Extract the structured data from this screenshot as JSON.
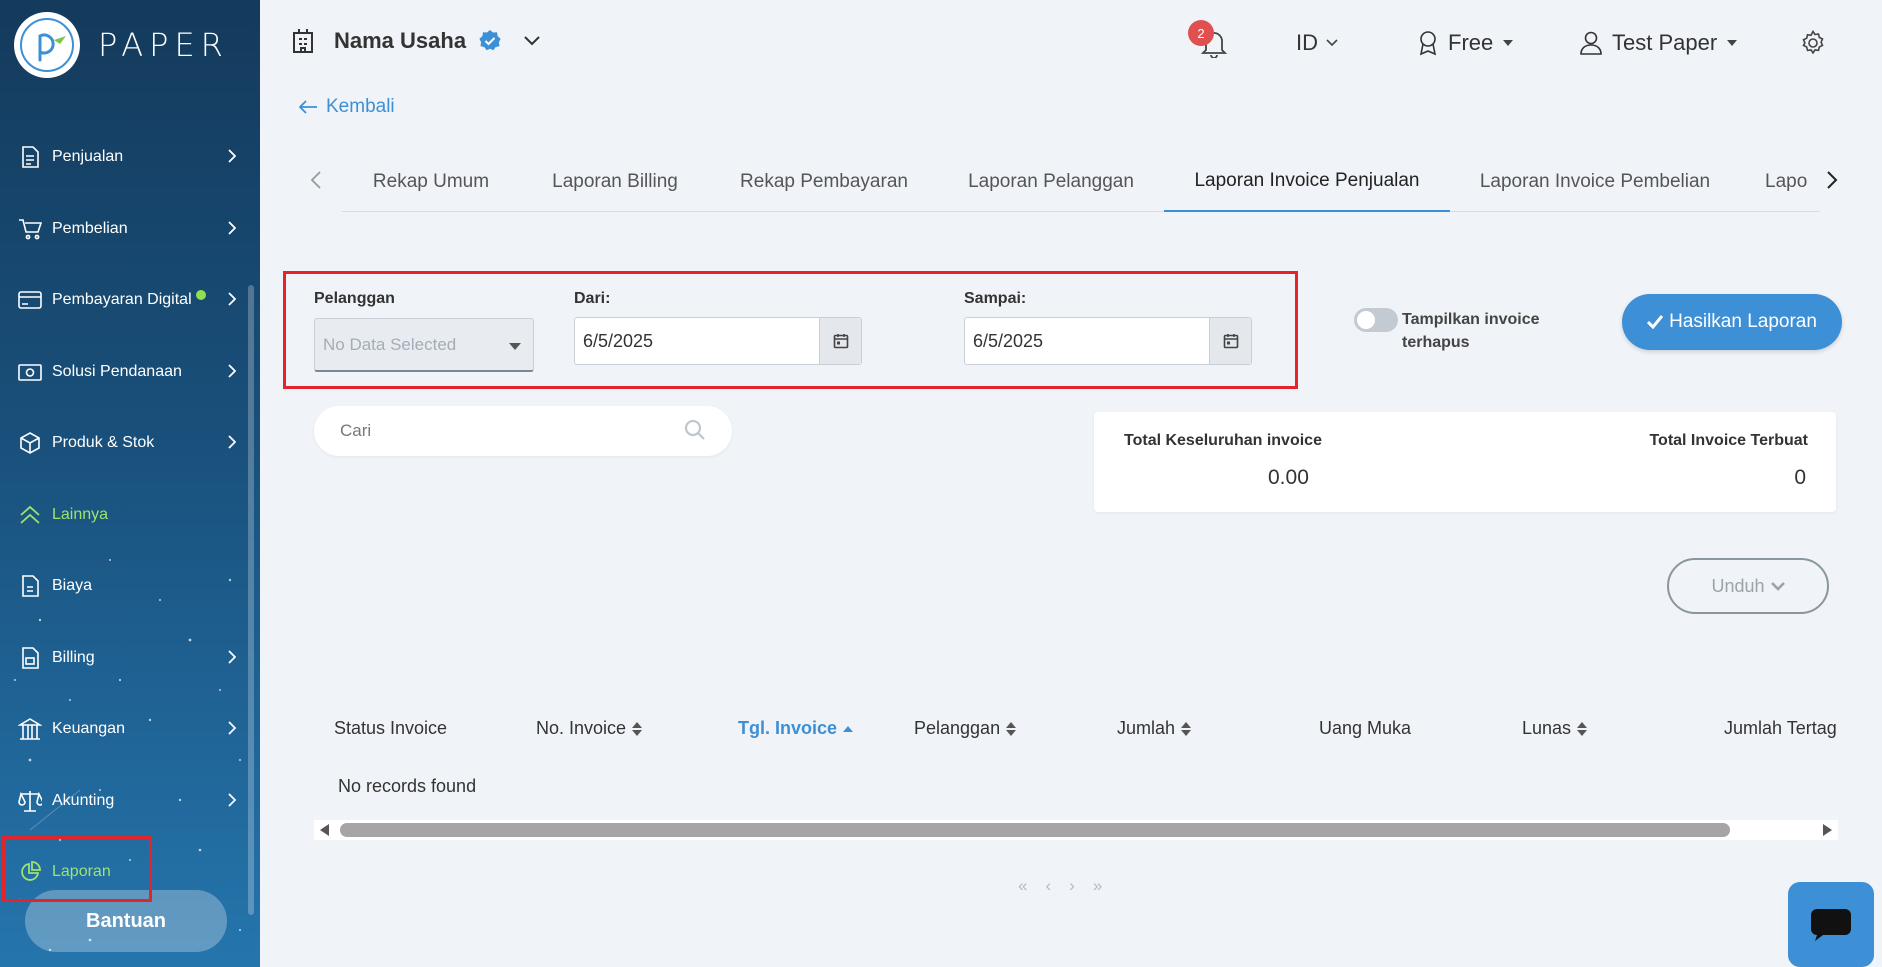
{
  "brand": {
    "name": "PAPER"
  },
  "sidebar": {
    "items": [
      {
        "label": "Penjualan",
        "icon": "document-icon",
        "has_submenu": true
      },
      {
        "label": "Pembelian",
        "icon": "cart-icon",
        "has_submenu": true
      },
      {
        "label": "Pembayaran Digital",
        "icon": "card-icon",
        "has_submenu": true,
        "dot": true
      },
      {
        "label": "Solusi Pendanaan",
        "icon": "wallet-icon",
        "has_submenu": true
      },
      {
        "label": "Produk & Stok",
        "icon": "box-icon",
        "has_submenu": true
      },
      {
        "label": "Lainnya",
        "icon": "double-chevron-up-icon",
        "has_submenu": false,
        "highlight": true
      },
      {
        "label": "Biaya",
        "icon": "receipt-icon",
        "has_submenu": false
      },
      {
        "label": "Billing",
        "icon": "billing-icon",
        "has_submenu": true
      },
      {
        "label": "Keuangan",
        "icon": "bank-icon",
        "has_submenu": true
      },
      {
        "label": "Akunting",
        "icon": "scale-icon",
        "has_submenu": true
      },
      {
        "label": "Laporan",
        "icon": "pie-chart-icon",
        "has_submenu": false,
        "active": true
      }
    ],
    "help_button": "Bantuan"
  },
  "header": {
    "business_name": "Nama Usaha",
    "notification_count": "2",
    "language": "ID",
    "plan": "Free",
    "user": "Test Paper"
  },
  "back_link": "Kembali",
  "tabs": [
    {
      "label": "Rekap Umum"
    },
    {
      "label": "Laporan Billing"
    },
    {
      "label": "Rekap Pembayaran"
    },
    {
      "label": "Laporan Pelanggan"
    },
    {
      "label": "Laporan Invoice Penjualan",
      "active": true
    },
    {
      "label": "Laporan Invoice Pembelian"
    },
    {
      "label": "Lapo"
    }
  ],
  "filter": {
    "customer_label": "Pelanggan",
    "customer_placeholder": "No Data Selected",
    "from_label": "Dari:",
    "from_value": "6/5/2025",
    "to_label": "Sampai:",
    "to_value": "6/5/2025",
    "show_deleted_label": "Tampilkan invoice terhapus",
    "generate_button": "Hasilkan Laporan"
  },
  "search": {
    "placeholder": "Cari"
  },
  "summary": {
    "total_all_label": "Total Keseluruhan invoice",
    "total_all_value": "0.00",
    "total_created_label": "Total Invoice Terbuat",
    "total_created_value": "0"
  },
  "download_button": "Unduh",
  "table": {
    "columns": [
      {
        "label": "Status Invoice",
        "sortable": false
      },
      {
        "label": "No. Invoice",
        "sortable": true
      },
      {
        "label": "Tgl. Invoice",
        "sortable": true,
        "active": true
      },
      {
        "label": "Pelanggan",
        "sortable": true
      },
      {
        "label": "Jumlah",
        "sortable": true
      },
      {
        "label": "Uang Muka",
        "sortable": false
      },
      {
        "label": "Lunas",
        "sortable": true
      },
      {
        "label": "Jumlah Tertag",
        "sortable": false
      }
    ],
    "empty_message": "No records found"
  },
  "pager": {
    "first": "«",
    "prev": "‹",
    "next": "›",
    "last": "»"
  },
  "colors": {
    "accent": "#3d8fd6",
    "highlight_green": "#9ee36f",
    "annotation_red": "#e3242b"
  }
}
